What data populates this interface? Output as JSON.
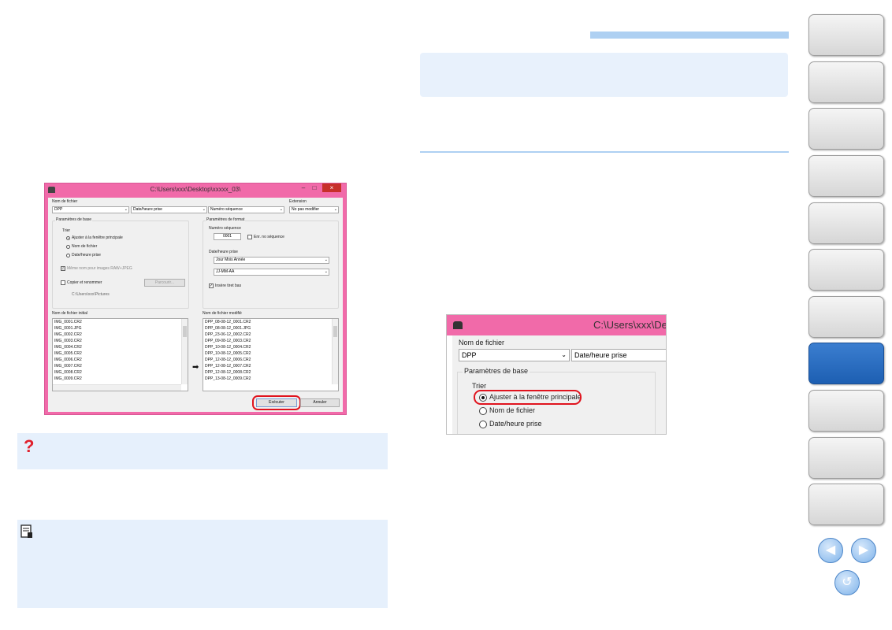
{
  "dialog": {
    "title": "C:\\Users\\xxx\\Desktop\\xxxxx_03\\",
    "minimize": "–",
    "maximize": "□",
    "close": "×",
    "nom_de_fichier_label": "Nom de fichier",
    "name_select": "DPP",
    "date_select": "Date/heure prise",
    "seq_select": "Numéro séquence",
    "extension_label": "Extension",
    "extension_select": "No pas modifier",
    "basic_group": "Paramètres de base",
    "trier_label": "Trier",
    "trier_options": [
      "Ajuster à la fenêtre principale",
      "Nom de fichier",
      "Date/heure prise"
    ],
    "same_name_label": "Même nom pour images RAW+JPEG",
    "copy_rename_label": "Copier et renommer",
    "parcourir_label": "Parcourir...",
    "path": "C:\\Users\\xxx\\Pictures",
    "format_group": "Paramètres de format",
    "seq_label": "Numéro séquence",
    "seq_value": "0001",
    "enr_label": "Enr. no séquence",
    "date_label": "Date/heure prise",
    "date_format_1": "Jour Mois Année",
    "date_format_2": "JJ-MM-AA",
    "underscore_label": "Insère tiret bas",
    "initial_label": "Nom de fichier initial",
    "initial_files": [
      "IMG_0001.CR2",
      "IMG_0001.JPG",
      "IMG_0002.CR2",
      "IMG_0003.CR2",
      "IMG_0004.CR2",
      "IMG_0005.CR2",
      "IMG_0006.CR2",
      "IMG_0007.CR2",
      "IMG_0008.CR2",
      "IMG_0009.CR2"
    ],
    "modified_label": "Nom de fichier modifié",
    "modified_files": [
      "DPP_08-08-12_0001.CR2",
      "DPP_08-08-12_0001.JPG",
      "DPP_23-06-12_0002.CR2",
      "DPP_09-08-12_0003.CR2",
      "DPP_10-08-12_0004.CR2",
      "DPP_10-08-12_0005.CR2",
      "DPP_12-08-12_0006.CR2",
      "DPP_12-08-12_0007.CR2",
      "DPP_12-08-12_0008.CR2",
      "DPP_13-08-12_0009.CR2"
    ],
    "arrow": "➡",
    "execute_button": "Exécuter",
    "cancel_button": "Annuler"
  },
  "zoom": {
    "title": "C:\\Users\\xxx\\Desk",
    "nom_de_fichier_label": "Nom de fichier",
    "name_select": "DPP",
    "date_select": "Date/heure prise",
    "basic_group": "Paramètres de base",
    "trier_label": "Trier",
    "trier_options": [
      "Ajuster à la fenêtre principale",
      "Nom de fichier",
      "Date/heure prise"
    ]
  },
  "help_box": {
    "icon_glyph": "?"
  },
  "nav": {
    "tab_count": 11,
    "active_index": 7,
    "prev_glyph": "◀",
    "next_glyph": "▶",
    "return_glyph": "↺"
  },
  "colors": {
    "dialog_titlebar": "#f16aa9",
    "highlight_box": "#e8f1fc",
    "rule": "#aed0f2",
    "emphasis_oval": "#e0141e",
    "active_tab": "#2a6ec4"
  }
}
